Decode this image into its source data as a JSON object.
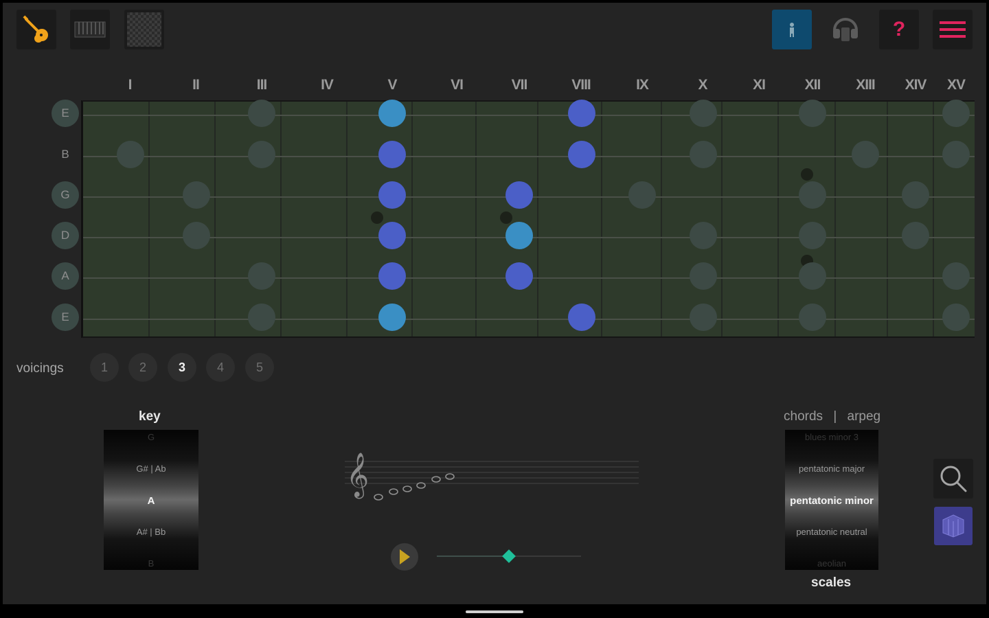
{
  "toolbar": {
    "left": [
      {
        "name": "guitar-icon"
      },
      {
        "name": "piano-icon"
      },
      {
        "name": "grid-pattern-icon"
      }
    ],
    "right": [
      {
        "name": "person-icon",
        "color": "#0e4a6e"
      },
      {
        "name": "headphones-icon"
      },
      {
        "name": "help-icon",
        "label": "?",
        "color": "#e0245e"
      },
      {
        "name": "menu-icon",
        "color": "#e0245e"
      }
    ]
  },
  "fret_numerals": [
    "I",
    "II",
    "III",
    "IV",
    "V",
    "VI",
    "VII",
    "VIII",
    "IX",
    "X",
    "XI",
    "XII",
    "XIII",
    "XIV",
    "XV"
  ],
  "strings": [
    "E",
    "B",
    "G",
    "D",
    "A",
    "E"
  ],
  "highlight_colors": {
    "note": "#4b5fc7",
    "root": "#3a8fc4",
    "scale": "#3d4a45",
    "fretboard": "#2e3a2b"
  },
  "voicings": {
    "label": "voicings",
    "options": [
      "1",
      "2",
      "3",
      "4",
      "5"
    ],
    "selected": "3"
  },
  "key": {
    "title": "key",
    "items": [
      "G",
      "G# | Ab",
      "A",
      "A# | Bb",
      "B"
    ],
    "selected": "A"
  },
  "chords_arpeg": {
    "chords": "chords",
    "separator": "|",
    "arpeg": "arpeg"
  },
  "scales": {
    "title": "scales",
    "items": [
      "blues minor 3",
      "pentatonic major",
      "pentatonic minor",
      "pentatonic neutral",
      "aeolian"
    ],
    "selected": "pentatonic minor"
  },
  "player": {
    "play_icon": "play-icon",
    "speed": 0.5
  }
}
